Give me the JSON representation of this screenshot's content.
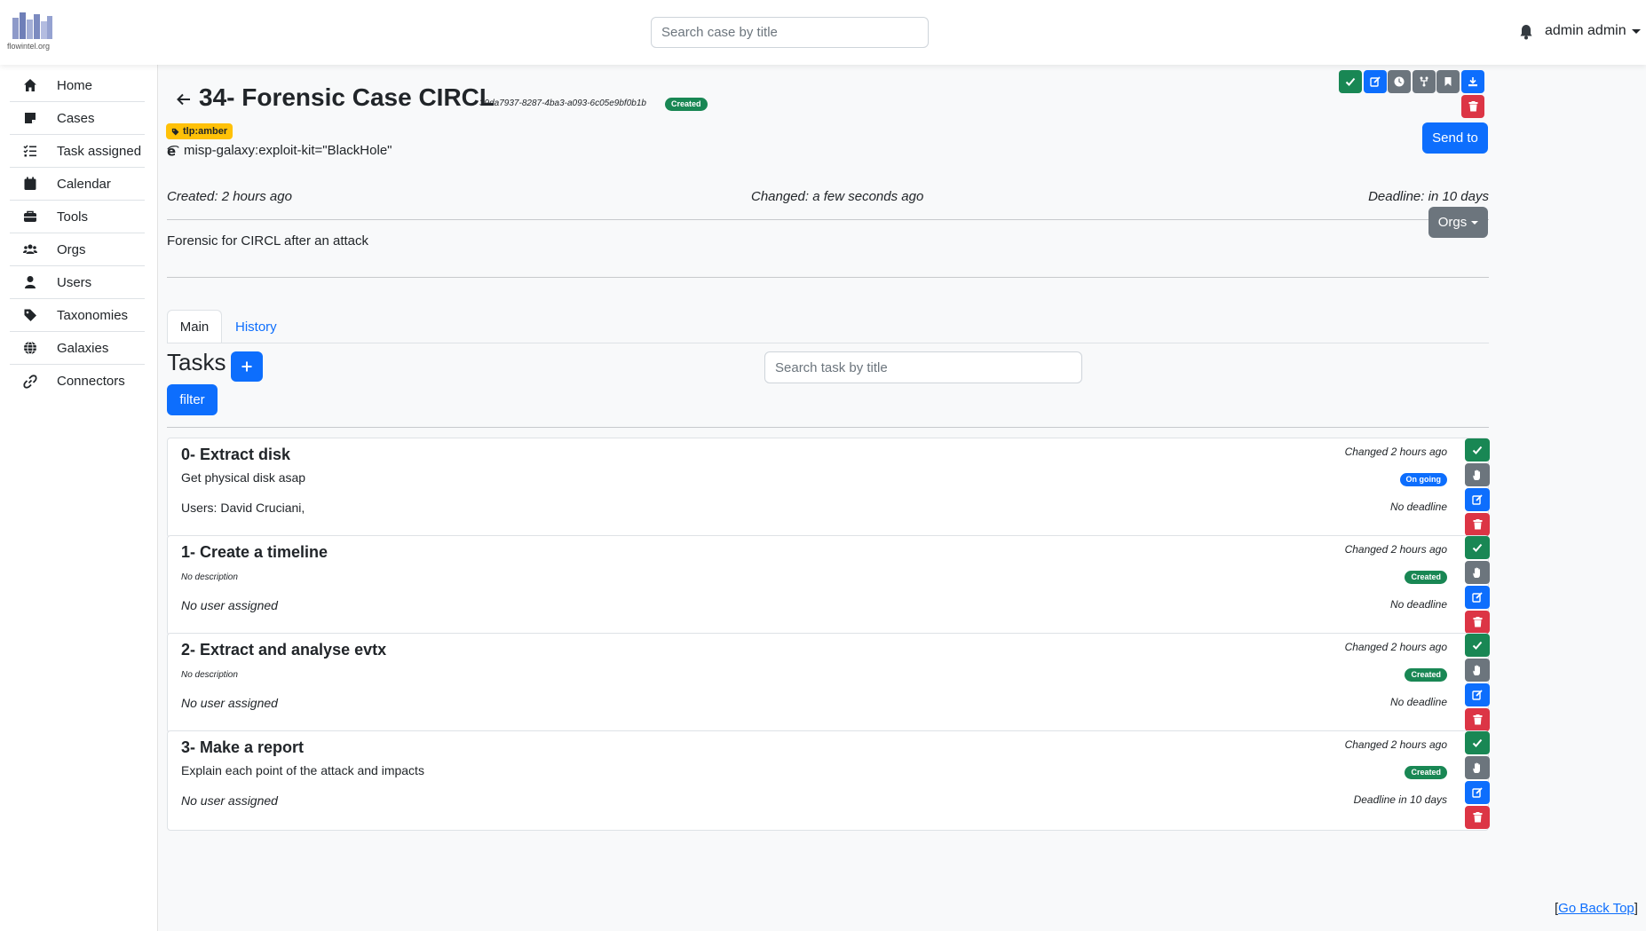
{
  "navbar": {
    "logo_text": "flowintel.org",
    "search_placeholder": "Search case by title",
    "user_name": "admin admin"
  },
  "sidebar": {
    "items": [
      {
        "label": "Home",
        "icon": "home-icon"
      },
      {
        "label": "Cases",
        "icon": "note-icon"
      },
      {
        "label": "Task assigned",
        "icon": "list-check-icon"
      },
      {
        "label": "Calendar",
        "icon": "calendar-icon"
      },
      {
        "label": "Tools",
        "icon": "toolbox-icon"
      },
      {
        "label": "Orgs",
        "icon": "users-group-icon"
      },
      {
        "label": "Users",
        "icon": "user-icon"
      },
      {
        "label": "Taxonomies",
        "icon": "tag-icon"
      },
      {
        "label": "Galaxies",
        "icon": "globe-icon"
      },
      {
        "label": "Connectors",
        "icon": "link-icon"
      }
    ]
  },
  "case": {
    "title": "34- Forensic Case CIRCL",
    "uuid": "39da7937-8287-4ba3-a093-6c05e9bf0b1b",
    "status": "Created",
    "tag": "tlp:amber",
    "galaxy": "misp-galaxy:exploit-kit=\"BlackHole\"",
    "created": "Created: 2 hours ago",
    "changed": "Changed: a few seconds ago",
    "deadline": "Deadline: in 10 days",
    "description": "Forensic for CIRCL after an attack",
    "send_to_label": "Send to",
    "orgs_label": "Orgs",
    "colors": {
      "success": "#198754",
      "primary": "#0d6efd",
      "secondary": "#6c757d",
      "danger": "#dc3545",
      "warning": "#ffc107"
    }
  },
  "tabs": [
    {
      "label": "Main",
      "active": true
    },
    {
      "label": "History",
      "active": false
    }
  ],
  "tasks_section": {
    "heading": "Tasks",
    "add_label": "+",
    "filter_label": "filter",
    "search_placeholder": "Search task by title"
  },
  "tasks": [
    {
      "title": "0- Extract disk",
      "description": "Get physical disk asap",
      "users": "Users: David Cruciani,",
      "changed": "Changed 2 hours ago",
      "status": "On going",
      "deadline": "No deadline"
    },
    {
      "title": "1- Create a timeline",
      "description": "No description",
      "users": "No user assigned",
      "changed": "Changed 2 hours ago",
      "status": "Created",
      "deadline": "No deadline"
    },
    {
      "title": "2- Extract and analyse evtx",
      "description": "No description",
      "users": "No user assigned",
      "changed": "Changed 2 hours ago",
      "status": "Created",
      "deadline": "No deadline"
    },
    {
      "title": "3- Make a report",
      "description": "Explain each point of the attack and impacts",
      "users": "No user assigned",
      "changed": "Changed 2 hours ago",
      "status": "Created",
      "deadline": "Deadline in 10 days"
    }
  ],
  "footer": {
    "bracket_open": "[",
    "go_top_label": "Go Back Top",
    "bracket_close": "]"
  }
}
